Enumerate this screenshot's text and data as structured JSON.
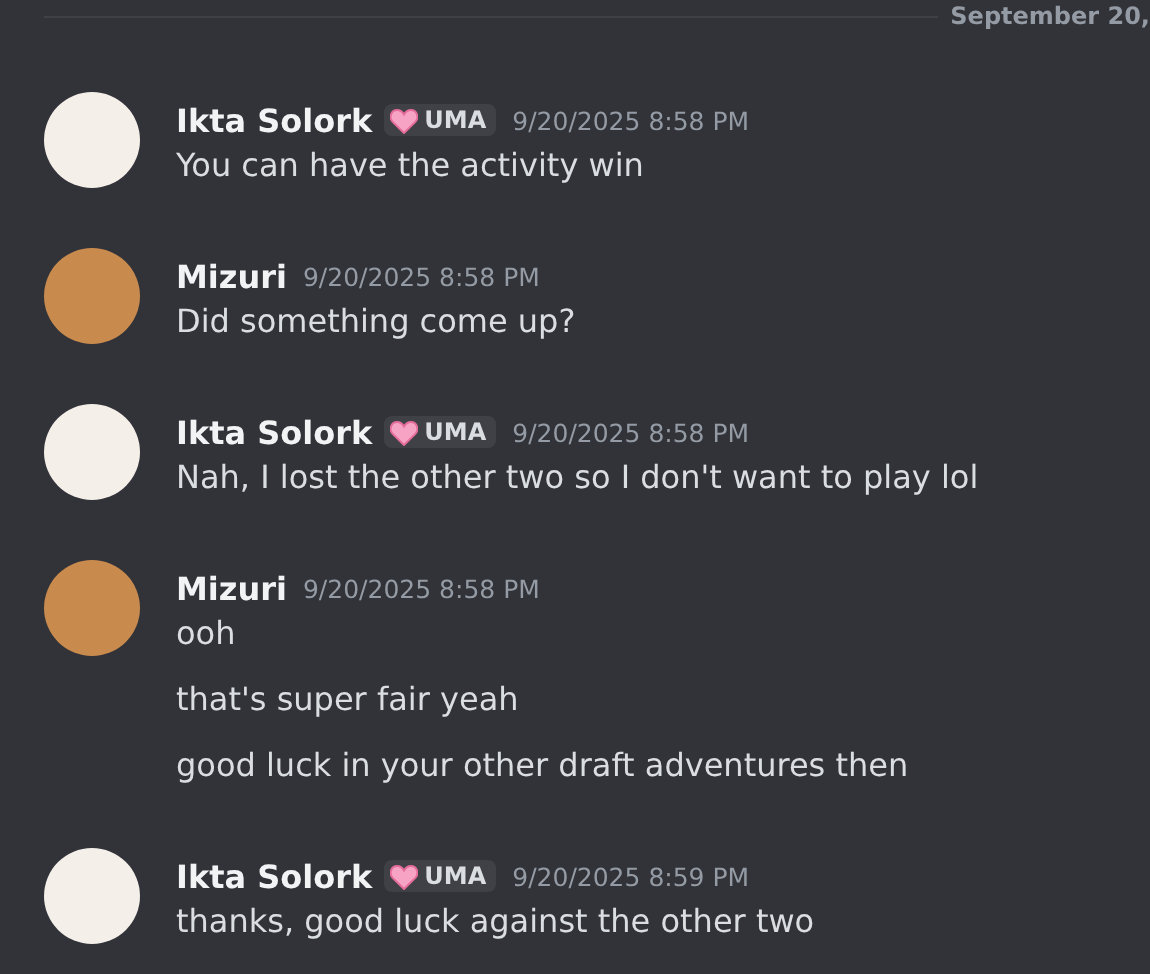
{
  "date_divider": "September 20,",
  "groups": [
    {
      "author": "Ikta Solork",
      "color": "#f4efe9",
      "tag": "UMA",
      "time": "9/20/2025 8:58 PM",
      "messages": [
        "You can have the activity win"
      ]
    },
    {
      "author": "Mizuri",
      "color": "#c98a4e",
      "time": "9/20/2025 8:58 PM",
      "messages": [
        "Did something come up?"
      ]
    },
    {
      "author": "Ikta Solork",
      "color": "#f4efe9",
      "tag": "UMA",
      "time": "9/20/2025 8:58 PM",
      "messages": [
        "Nah, I lost the other two so I don't want to play lol"
      ]
    },
    {
      "author": "Mizuri",
      "color": "#c98a4e",
      "time": "9/20/2025 8:58 PM",
      "messages": [
        "ooh",
        "that's super fair yeah",
        "good luck in your other draft adventures then"
      ]
    },
    {
      "author": "Ikta Solork",
      "color": "#f4efe9",
      "tag": "UMA",
      "time": "9/20/2025 8:59 PM",
      "messages": [
        "thanks, good luck against the other two"
      ]
    }
  ]
}
